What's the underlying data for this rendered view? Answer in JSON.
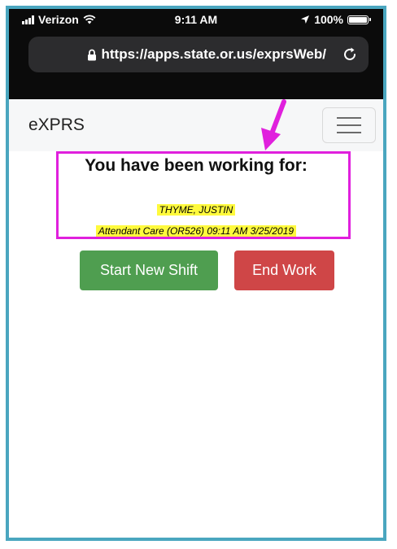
{
  "status_bar": {
    "carrier": "Verizon",
    "time": "9:11 AM",
    "battery_percent": "100%"
  },
  "browser": {
    "url": "https://apps.state.or.us/exprsWeb/"
  },
  "navbar": {
    "brand": "eXPRS"
  },
  "main": {
    "heading": "You have been working for:",
    "client_name": "THYME, JUSTIN",
    "service_info": "Attendant Care (OR526) 09:11 AM 3/25/2019"
  },
  "actions": {
    "start_label": "Start New Shift",
    "end_label": "End Work"
  },
  "colors": {
    "frame_border": "#4aa6bf",
    "annotation": "#e020dd",
    "highlight": "#fffa3d",
    "start_button": "#4f9e50",
    "end_button": "#cf4647"
  },
  "icons": {
    "status": [
      "signal-bars-icon",
      "wifi-icon",
      "location-arrow-icon",
      "battery-icon"
    ],
    "browser": [
      "lock-icon",
      "reload-icon"
    ],
    "nav": [
      "hamburger-menu-icon"
    ],
    "annotation": [
      "pointer-arrow-icon"
    ]
  }
}
